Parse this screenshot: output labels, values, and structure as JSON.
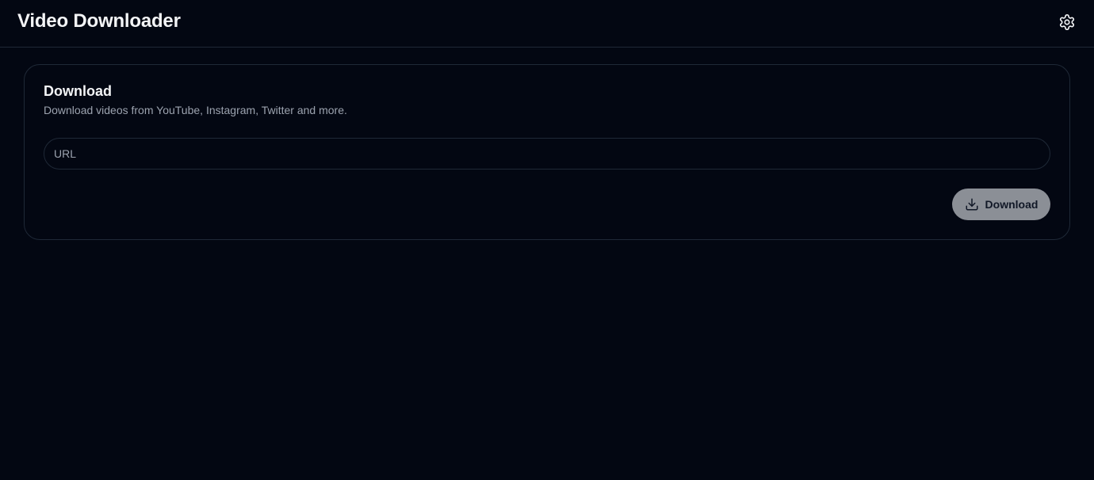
{
  "header": {
    "title": "Video Downloader",
    "settings_icon": "gear-icon"
  },
  "card": {
    "title": "Download",
    "subtitle": "Download videos from YouTube, Instagram, Twitter and more.",
    "url_input": {
      "value": "",
      "placeholder": "URL"
    },
    "download_button": {
      "label": "Download",
      "icon": "download-icon",
      "disabled": true
    }
  },
  "colors": {
    "background": "#030712",
    "border": "#1f2937",
    "text": "#f3f4f6",
    "muted_text": "#9ca3af",
    "button_background": "#8b8f96",
    "button_text": "#111827"
  }
}
